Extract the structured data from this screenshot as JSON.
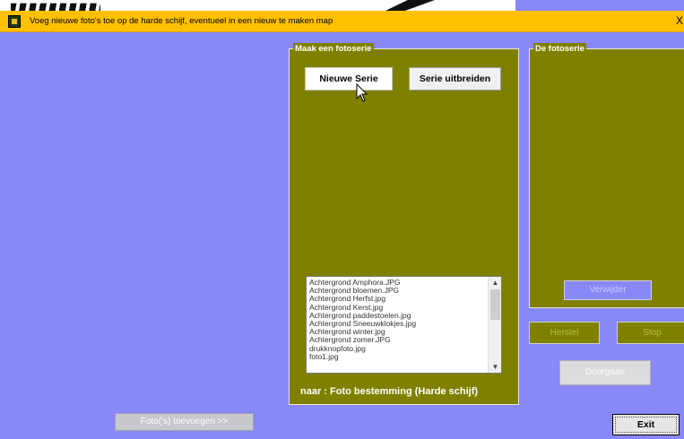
{
  "window": {
    "title": "Voeg nieuwe foto's toe op de harde schijf, eventueel in een nieuw te maken map",
    "close_glyph": "X"
  },
  "left_panel": {
    "legend": "Maak een fotoserie",
    "new_series_label": "Nieuwe Serie",
    "extend_series_label": "Serie uitbreiden",
    "files": [
      "Achtergrond Amphora.JPG",
      "Achtergrond bloemen.JPG",
      "Achtergrond Herfst.jpg",
      "Achtergrond Kerst.jpg",
      "Achtergrond paddestoelen.jpg",
      "Achtergrond Sneeuwklokjes.jpg",
      "Achtergrond winter.jpg",
      "Achtergrond zomer.JPG",
      "drukknopfoto.jpg",
      "foto1.jpg"
    ],
    "destination_label": "naar :  Foto bestemming (Harde schijf)"
  },
  "right_panel": {
    "legend": "De fotoserie",
    "remove_label": "Verwijder"
  },
  "right_buttons": {
    "left_label": "Herstel",
    "right_label": "Stop"
  },
  "continue_label": "Doorgaan",
  "add_photos_label": "Foto('s) toevoegen >>",
  "exit_label": "Exit",
  "colors": {
    "background": "#8888f8",
    "titlebar": "#ffc000",
    "panel": "#808000"
  },
  "icons": [
    "app-icon",
    "close-icon",
    "scroll-up-icon",
    "scroll-down-icon",
    "mouse-cursor-icon"
  ]
}
